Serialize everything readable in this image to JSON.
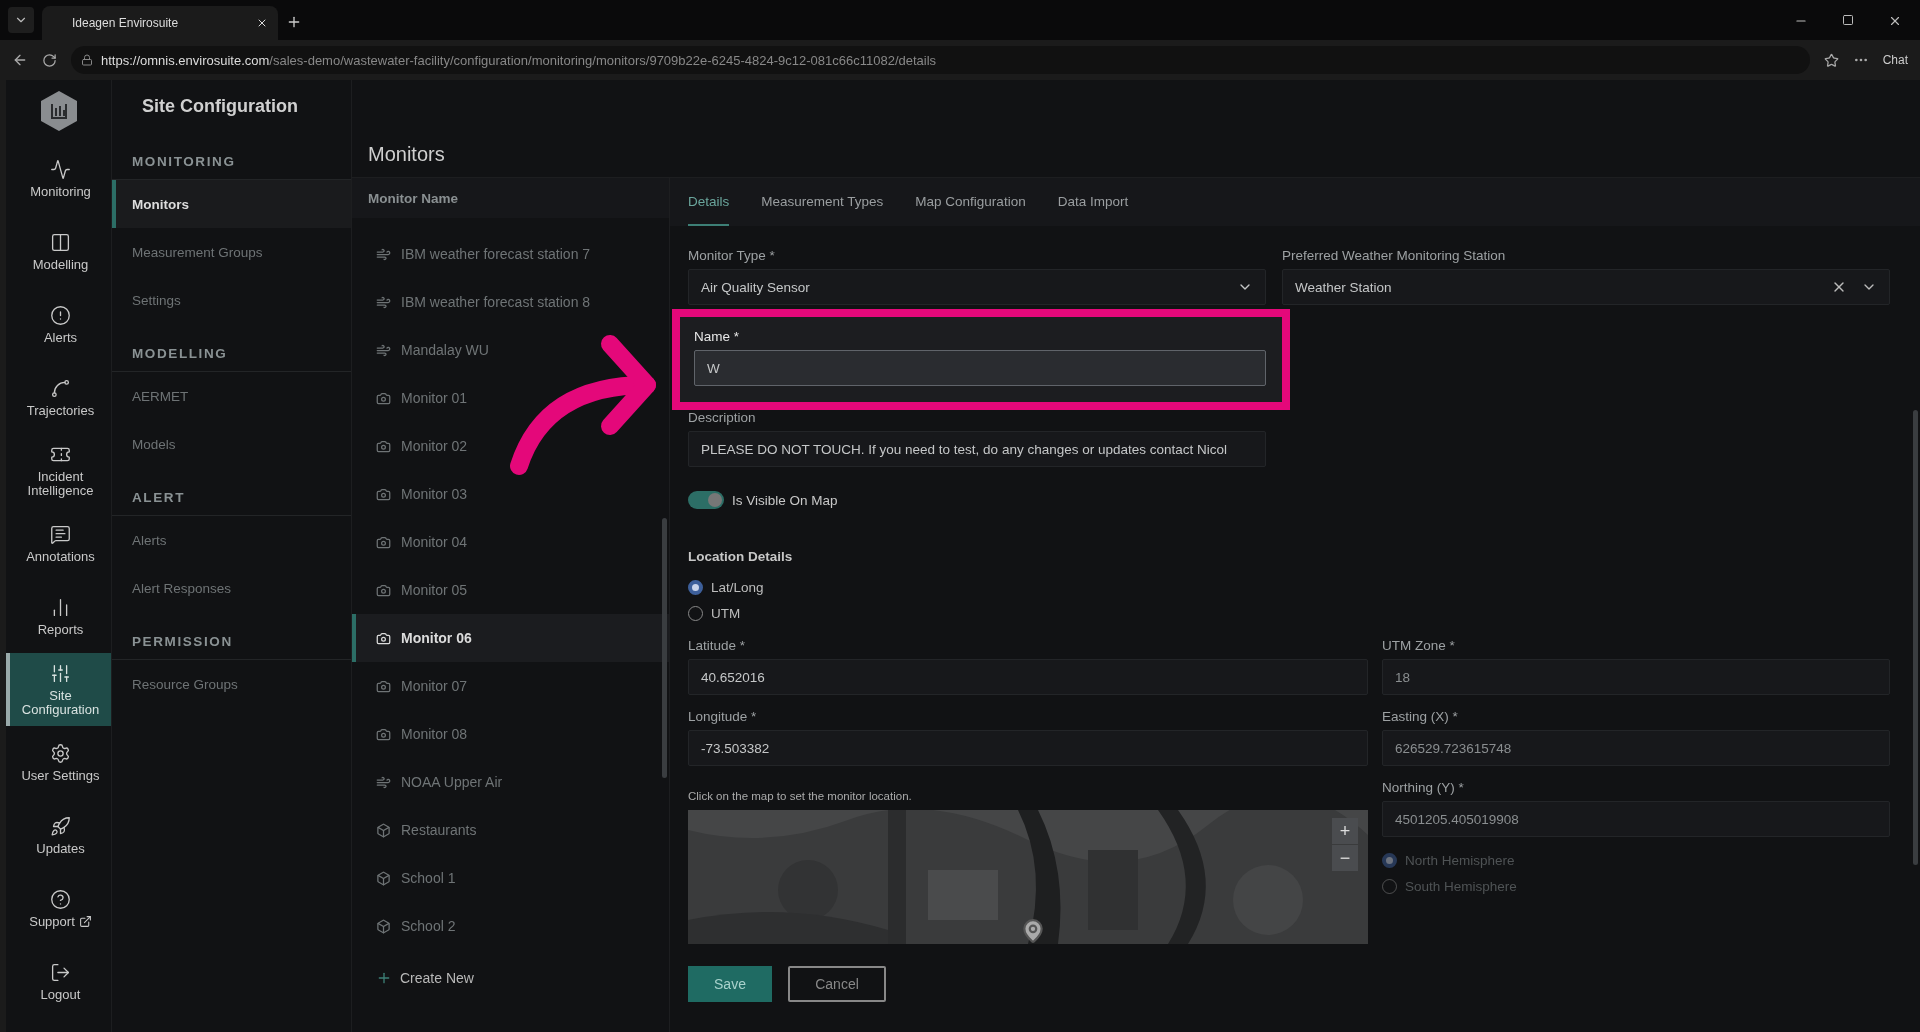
{
  "browser": {
    "tab_title": "Ideagen Envirosuite",
    "url_host": "https://omnis.envirosuite.com",
    "url_path": "/sales-demo/wastewater-facility/configuration/monitoring/monitors/9709b22e-6245-4824-9c12-081c66c11082/details",
    "chat_label": "Chat"
  },
  "rail": [
    {
      "label": "Monitoring",
      "selected": false
    },
    {
      "label": "Modelling",
      "selected": false
    },
    {
      "label": "Alerts",
      "selected": false
    },
    {
      "label": "Trajectories",
      "selected": false
    },
    {
      "label": "Incident Intelligence",
      "selected": false
    },
    {
      "label": "Annotations",
      "selected": false
    },
    {
      "label": "Reports",
      "selected": false
    },
    {
      "label": "Site Configuration",
      "selected": true
    },
    {
      "label": "User Settings",
      "selected": false
    },
    {
      "label": "Updates",
      "selected": false
    },
    {
      "label": "Support",
      "selected": false,
      "external": true
    },
    {
      "label": "Logout",
      "selected": false
    }
  ],
  "section_nav": {
    "title": "Site Configuration",
    "groups": [
      {
        "title": "MONITORING",
        "items": [
          {
            "label": "Monitors",
            "selected": true
          },
          {
            "label": "Measurement Groups",
            "selected": false
          },
          {
            "label": "Settings",
            "selected": false
          }
        ]
      },
      {
        "title": "MODELLING",
        "items": [
          {
            "label": "AERMET",
            "selected": false
          },
          {
            "label": "Models",
            "selected": false
          }
        ]
      },
      {
        "title": "ALERT",
        "items": [
          {
            "label": "Alerts",
            "selected": false
          },
          {
            "label": "Alert Responses",
            "selected": false
          }
        ]
      },
      {
        "title": "PERMISSION",
        "items": [
          {
            "label": "Resource Groups",
            "selected": false
          }
        ]
      }
    ]
  },
  "monitors": {
    "title": "Monitors",
    "column": "Monitor Name",
    "create_label": "Create New",
    "items": [
      {
        "label": "IBM weather forecast station 7",
        "kind": "wind",
        "selected": false
      },
      {
        "label": "IBM weather forecast station 8",
        "kind": "wind",
        "selected": false
      },
      {
        "label": "Mandalay WU",
        "kind": "wind",
        "selected": false
      },
      {
        "label": "Monitor 01",
        "kind": "sensor",
        "selected": false
      },
      {
        "label": "Monitor 02",
        "kind": "sensor",
        "selected": false
      },
      {
        "label": "Monitor 03",
        "kind": "sensor",
        "selected": false
      },
      {
        "label": "Monitor 04",
        "kind": "sensor",
        "selected": false
      },
      {
        "label": "Monitor 05",
        "kind": "sensor",
        "selected": false
      },
      {
        "label": "Monitor 06",
        "kind": "sensor",
        "selected": true
      },
      {
        "label": "Monitor 07",
        "kind": "sensor",
        "selected": false
      },
      {
        "label": "Monitor 08",
        "kind": "sensor",
        "selected": false
      },
      {
        "label": "NOAA Upper Air",
        "kind": "wind",
        "selected": false
      },
      {
        "label": "Restaurants",
        "kind": "site",
        "selected": false
      },
      {
        "label": "School 1",
        "kind": "site",
        "selected": false
      },
      {
        "label": "School 2",
        "kind": "site",
        "selected": false
      }
    ]
  },
  "details": {
    "tabs": [
      {
        "label": "Details",
        "selected": true
      },
      {
        "label": "Measurement Types",
        "selected": false
      },
      {
        "label": "Map Configuration",
        "selected": false
      },
      {
        "label": "Data Import",
        "selected": false
      }
    ],
    "monitor_type": {
      "label": "Monitor Type *",
      "value": "Air Quality Sensor"
    },
    "weather_station": {
      "label": "Preferred Weather Monitoring Station",
      "value": "Weather Station"
    },
    "name": {
      "label": "Name *",
      "value": "W",
      "highlighted": true
    },
    "description": {
      "label": "Description",
      "value": "PLEASE DO NOT TOUCH. If you need to test, do any changes or updates contact Nicol"
    },
    "visible_on_map": {
      "label": "Is Visible On Map",
      "on": true
    },
    "location": {
      "title": "Location Details",
      "modes": [
        {
          "label": "Lat/Long",
          "selected": true
        },
        {
          "label": "UTM",
          "selected": false
        }
      ],
      "latitude": {
        "label": "Latitude *",
        "value": "40.652016"
      },
      "longitude": {
        "label": "Longitude *",
        "value": "-73.503382"
      },
      "map_hint": "Click on the map to set the monitor location.",
      "zoom_in": "+",
      "zoom_out": "−",
      "utm_zone": {
        "label": "UTM Zone *",
        "value": "18"
      },
      "easting": {
        "label": "Easting (X) *",
        "value": "626529.723615748"
      },
      "northing": {
        "label": "Northing (Y) *",
        "value": "4501205.405019908"
      },
      "hemispheres": [
        {
          "label": "North Hemisphere",
          "selected": true
        },
        {
          "label": "South Hemisphere",
          "selected": false
        }
      ]
    },
    "save_label": "Save",
    "cancel_label": "Cancel"
  }
}
